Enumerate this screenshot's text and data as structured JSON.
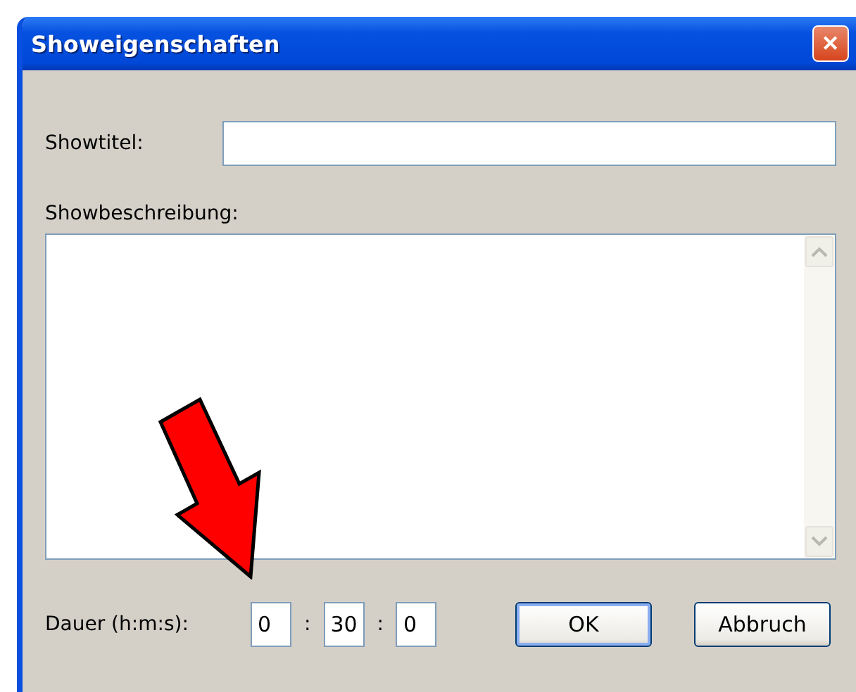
{
  "window": {
    "title": "Showeigenschaften",
    "close": "✕"
  },
  "title_field": {
    "label": "Showtitel:"
  },
  "description": {
    "label": "Showbeschreibung:"
  },
  "duration": {
    "label": "Dauer (h:m:s):",
    "hours": "0",
    "minutes": "30",
    "seconds": "0",
    "separators": [
      ":",
      ":"
    ]
  },
  "buttons": [
    {
      "label": "OK",
      "default": true
    },
    {
      "label": "Abbruch",
      "default": false
    }
  ]
}
